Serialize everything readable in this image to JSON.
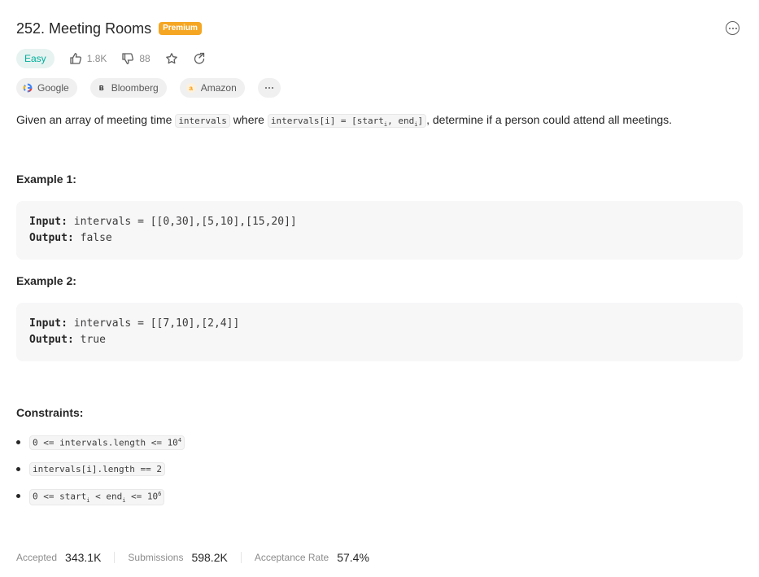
{
  "header": {
    "title": "252. Meeting Rooms",
    "badge": "Premium"
  },
  "meta": {
    "difficulty": "Easy",
    "likes": "1.8K",
    "dislikes": "88",
    "difficulty_color": "#00af9b"
  },
  "tags": [
    {
      "label": "Google",
      "icon": "google-icon"
    },
    {
      "label": "Bloomberg",
      "icon": "bloomberg-icon"
    },
    {
      "label": "Amazon",
      "icon": "amazon-icon"
    }
  ],
  "description": {
    "p1": "Given an array of meeting time ",
    "code1": "intervals",
    "p2": " where ",
    "code2_a": "intervals[i] = [start",
    "code2_sub1": "i",
    "code2_b": ", end",
    "code2_sub2": "i",
    "code2_c": "]",
    "p3": ", determine if a person could attend all meetings."
  },
  "examples": [
    {
      "heading": "Example 1:",
      "input_label": "Input:",
      "input": "intervals = [[0,30],[5,10],[15,20]]",
      "output_label": "Output:",
      "output": "false"
    },
    {
      "heading": "Example 2:",
      "input_label": "Input:",
      "input": "intervals = [[7,10],[2,4]]",
      "output_label": "Output:",
      "output": "true"
    }
  ],
  "constraints": {
    "heading": "Constraints:",
    "c1_a": "0 <= intervals.length <= 10",
    "c1_sup": "4",
    "c2": "intervals[i].length == 2",
    "c3_a": "0 <= start",
    "c3_sub1": "i",
    "c3_b": " < end",
    "c3_sub2": "i",
    "c3_c": " <= 10",
    "c3_sup": "6"
  },
  "stats": {
    "accepted_label": "Accepted",
    "accepted": "343.1K",
    "submissions_label": "Submissions",
    "submissions": "598.2K",
    "rate_label": "Acceptance Rate",
    "rate": "57.4%"
  }
}
